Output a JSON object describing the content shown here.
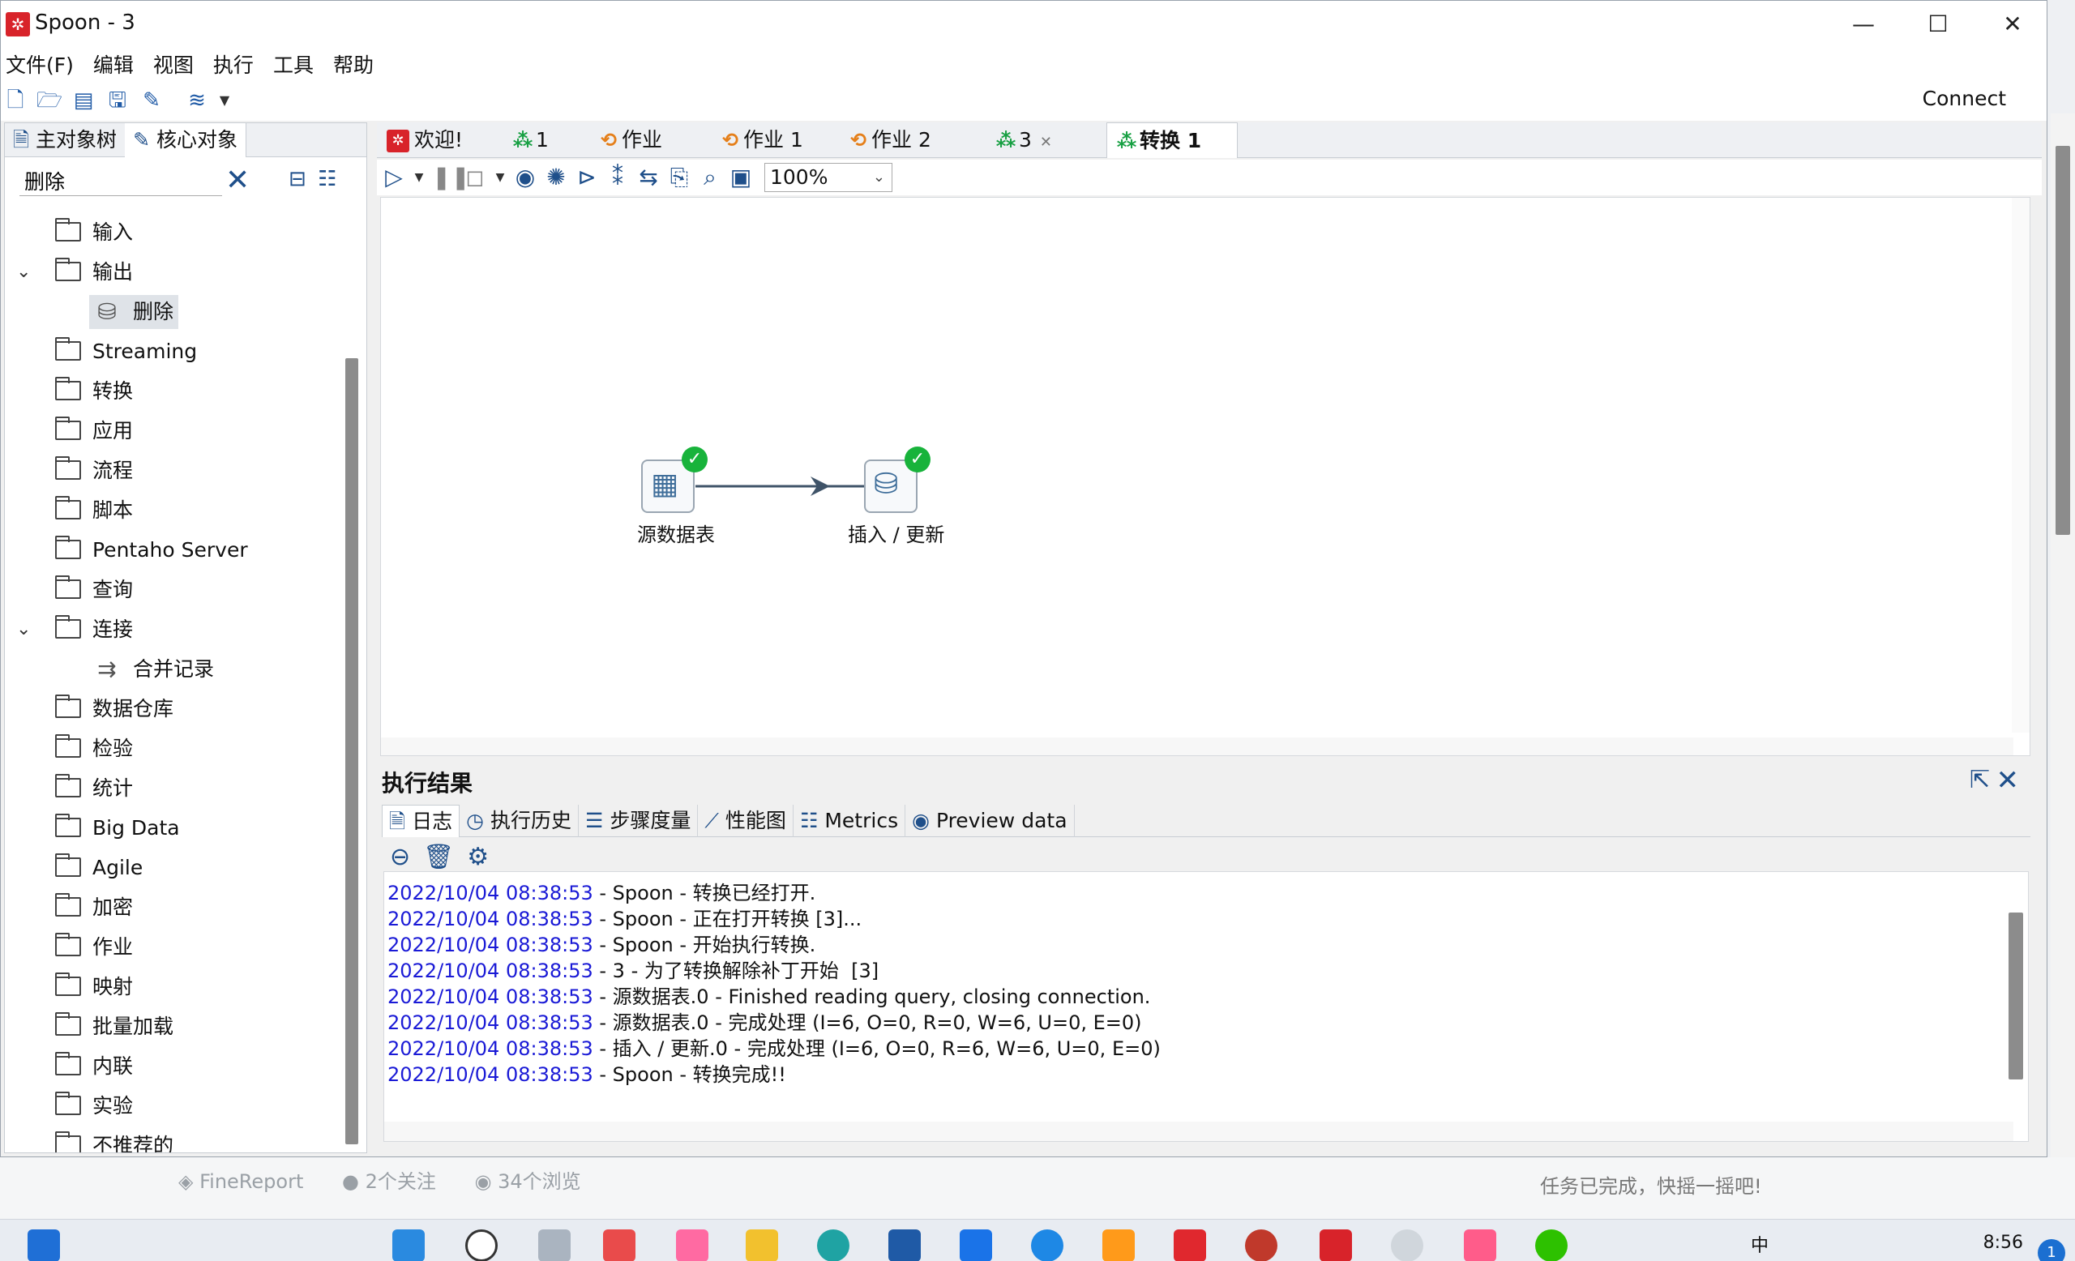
{
  "window": {
    "title": "Spoon - 3",
    "minimize_icon": "minimize-icon",
    "maximize_icon": "maximize-icon",
    "close_icon": "close-icon"
  },
  "menu": [
    "文件(F)",
    "编辑",
    "视图",
    "执行",
    "工具",
    "帮助"
  ],
  "toolbar": {
    "connect_label": "Connect"
  },
  "left_panel": {
    "tabs": [
      "主对象树",
      "核心对象"
    ],
    "search_value": "删除",
    "tree": [
      {
        "label": "输入",
        "type": "folder",
        "expanded": false
      },
      {
        "label": "输出",
        "type": "folder",
        "expanded": true
      },
      {
        "label": "删除",
        "type": "step",
        "selected": true
      },
      {
        "label": "Streaming",
        "type": "folder",
        "expanded": false
      },
      {
        "label": "转换",
        "type": "folder",
        "expanded": false
      },
      {
        "label": "应用",
        "type": "folder",
        "expanded": false
      },
      {
        "label": "流程",
        "type": "folder",
        "expanded": false
      },
      {
        "label": "脚本",
        "type": "folder",
        "expanded": false
      },
      {
        "label": "Pentaho Server",
        "type": "folder",
        "expanded": false
      },
      {
        "label": "查询",
        "type": "folder",
        "expanded": false
      },
      {
        "label": "连接",
        "type": "folder",
        "expanded": true
      },
      {
        "label": "合并记录",
        "type": "step",
        "selected": false
      },
      {
        "label": "数据仓库",
        "type": "folder",
        "expanded": false
      },
      {
        "label": "检验",
        "type": "folder",
        "expanded": false
      },
      {
        "label": "统计",
        "type": "folder",
        "expanded": false
      },
      {
        "label": "Big Data",
        "type": "folder",
        "expanded": false
      },
      {
        "label": "Agile",
        "type": "folder",
        "expanded": false
      },
      {
        "label": "加密",
        "type": "folder",
        "expanded": false
      },
      {
        "label": "作业",
        "type": "folder",
        "expanded": false
      },
      {
        "label": "映射",
        "type": "folder",
        "expanded": false
      },
      {
        "label": "批量加载",
        "type": "folder",
        "expanded": false
      },
      {
        "label": "内联",
        "type": "folder",
        "expanded": false
      },
      {
        "label": "实验",
        "type": "folder",
        "expanded": false
      },
      {
        "label": "不推荐的",
        "type": "folder",
        "expanded": false
      }
    ]
  },
  "file_tabs": [
    {
      "label": "欢迎!",
      "kind": "welcome"
    },
    {
      "label": "1",
      "kind": "transformation"
    },
    {
      "label": "作业",
      "kind": "job"
    },
    {
      "label": "作业 1",
      "kind": "job"
    },
    {
      "label": "作业 2",
      "kind": "job"
    },
    {
      "label": "3",
      "kind": "transformation",
      "closable": true
    },
    {
      "label": "转换 1",
      "kind": "transformation",
      "active": true
    }
  ],
  "canvas": {
    "zoom": "100%",
    "steps": [
      {
        "label": "源数据表",
        "status": "ok"
      },
      {
        "label": "插入 / 更新",
        "status": "ok"
      }
    ]
  },
  "results": {
    "title": "执行结果",
    "tabs": [
      "日志",
      "执行历史",
      "步骤度量",
      "性能图",
      "Metrics",
      "Preview data"
    ],
    "log": [
      {
        "ts": "2022/10/04 08:38:53",
        "msg": " - Spoon - 转换已经打开."
      },
      {
        "ts": "2022/10/04 08:38:53",
        "msg": " - Spoon - 正在打开转换 [3]..."
      },
      {
        "ts": "2022/10/04 08:38:53",
        "msg": " - Spoon - 开始执行转换."
      },
      {
        "ts": "2022/10/04 08:38:53",
        "msg": " - 3 - 为了转换解除补丁开始  [3]"
      },
      {
        "ts": "2022/10/04 08:38:53",
        "msg": " - 源数据表.0 - Finished reading query, closing connection."
      },
      {
        "ts": "2022/10/04 08:38:53",
        "msg": " - 源数据表.0 - 完成处理 (I=6, O=0, R=0, W=6, U=0, E=0)"
      },
      {
        "ts": "2022/10/04 08:38:53",
        "msg": " - 插入 / 更新.0 - 完成处理 (I=6, O=0, R=6, W=6, U=0, E=0)"
      },
      {
        "ts": "2022/10/04 08:38:53",
        "msg": " - Spoon - 转换完成!!"
      }
    ]
  },
  "background_page": {
    "meta_source": "FineReport",
    "meta_follow": "2个关注",
    "meta_views": "34个浏览",
    "task_text": "任务已完成，快摇一摇吧!"
  },
  "taskbar": {
    "time": "8:56",
    "ime": "中",
    "notification_count": "1"
  },
  "colors": {
    "timestamp": "#1a1ad6",
    "ok_badge": "#18b33b",
    "spoon_red": "#d8232a",
    "trans_green": "#18a043",
    "job_orange": "#e57f19"
  }
}
